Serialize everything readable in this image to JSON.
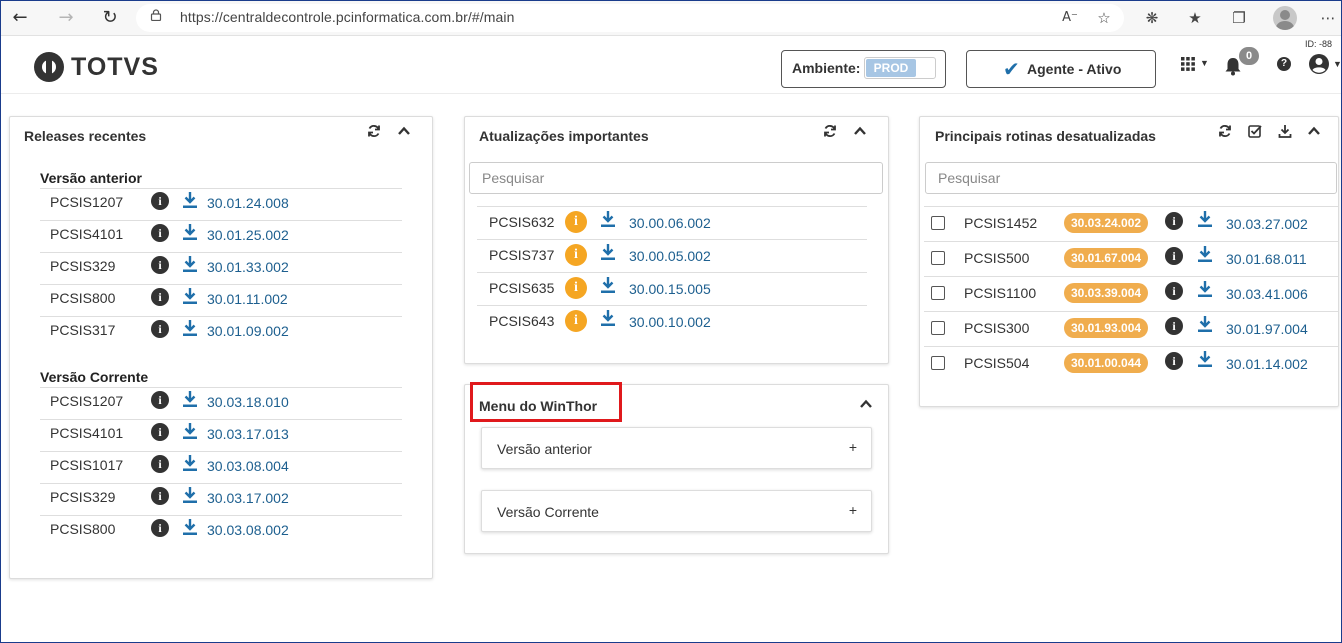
{
  "browser": {
    "url": "https://centraldecontrole.pcinformatica.com.br/#/main"
  },
  "header": {
    "logo_text": "TOTVS",
    "ambiente_label": "Ambiente:",
    "ambiente_value": "PROD",
    "agente_label": "Agente - Ativo",
    "notifications_count": "0",
    "help_label": "?",
    "id_label": "ID: -88"
  },
  "releases": {
    "title": "Releases recentes",
    "anterior_title": "Versão anterior",
    "anterior": [
      {
        "code": "PCSIS1207",
        "version": "30.01.24.008"
      },
      {
        "code": "PCSIS4101",
        "version": "30.01.25.002"
      },
      {
        "code": "PCSIS329",
        "version": "30.01.33.002"
      },
      {
        "code": "PCSIS800",
        "version": "30.01.11.002"
      },
      {
        "code": "PCSIS317",
        "version": "30.01.09.002"
      }
    ],
    "corrente_title": "Versão Corrente",
    "corrente": [
      {
        "code": "PCSIS1207",
        "version": "30.03.18.010"
      },
      {
        "code": "PCSIS4101",
        "version": "30.03.17.013"
      },
      {
        "code": "PCSIS1017",
        "version": "30.03.08.004"
      },
      {
        "code": "PCSIS329",
        "version": "30.03.17.002"
      },
      {
        "code": "PCSIS800",
        "version": "30.03.08.002"
      }
    ]
  },
  "updates": {
    "title": "Atualizações importantes",
    "search_placeholder": "Pesquisar",
    "items": [
      {
        "code": "PCSIS632",
        "version": "30.00.06.002"
      },
      {
        "code": "PCSIS737",
        "version": "30.00.05.002"
      },
      {
        "code": "PCSIS635",
        "version": "30.00.15.005"
      },
      {
        "code": "PCSIS643",
        "version": "30.00.10.002"
      }
    ]
  },
  "winthor": {
    "title": "Menu do WinThor",
    "items": [
      {
        "label": "Versão anterior",
        "toggle": "+"
      },
      {
        "label": "Versão Corrente",
        "toggle": "+"
      }
    ]
  },
  "outdated": {
    "title": "Principais rotinas desatualizadas",
    "search_placeholder": "Pesquisar",
    "items": [
      {
        "code": "PCSIS1452",
        "current": "30.03.24.002",
        "latest": "30.03.27.002"
      },
      {
        "code": "PCSIS500",
        "current": "30.01.67.004",
        "latest": "30.01.68.011"
      },
      {
        "code": "PCSIS1100",
        "current": "30.03.39.004",
        "latest": "30.03.41.006"
      },
      {
        "code": "PCSIS300",
        "current": "30.01.93.004",
        "latest": "30.01.97.004"
      },
      {
        "code": "PCSIS504",
        "current": "30.01.00.044",
        "latest": "30.01.14.002"
      }
    ]
  },
  "icons": {
    "info_glyph": "i"
  },
  "colors": {
    "link": "#1d5f8f",
    "download": "#1f6faa",
    "warning": "#f5a623",
    "pill": "#f0ad4e",
    "highlight": "#e0191c"
  }
}
